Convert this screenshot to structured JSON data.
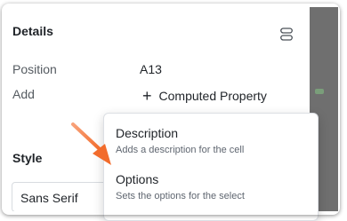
{
  "details": {
    "title": "Details",
    "rows": [
      {
        "label": "Position",
        "value": "A13"
      },
      {
        "label": "Add",
        "action": "Computed Property"
      }
    ]
  },
  "style": {
    "title": "Style",
    "font_value": "Sans Serif"
  },
  "dropdown": {
    "items": [
      {
        "title": "Description",
        "desc": "Adds a description for the cell"
      },
      {
        "title": "Options",
        "desc": "Sets the options for the select"
      }
    ]
  },
  "icons": {
    "menu": "stacked-lines-icon",
    "add": "plus-icon",
    "pointer": "orange-arrow-annotation"
  },
  "colors": {
    "arrow": "#f4844a"
  }
}
